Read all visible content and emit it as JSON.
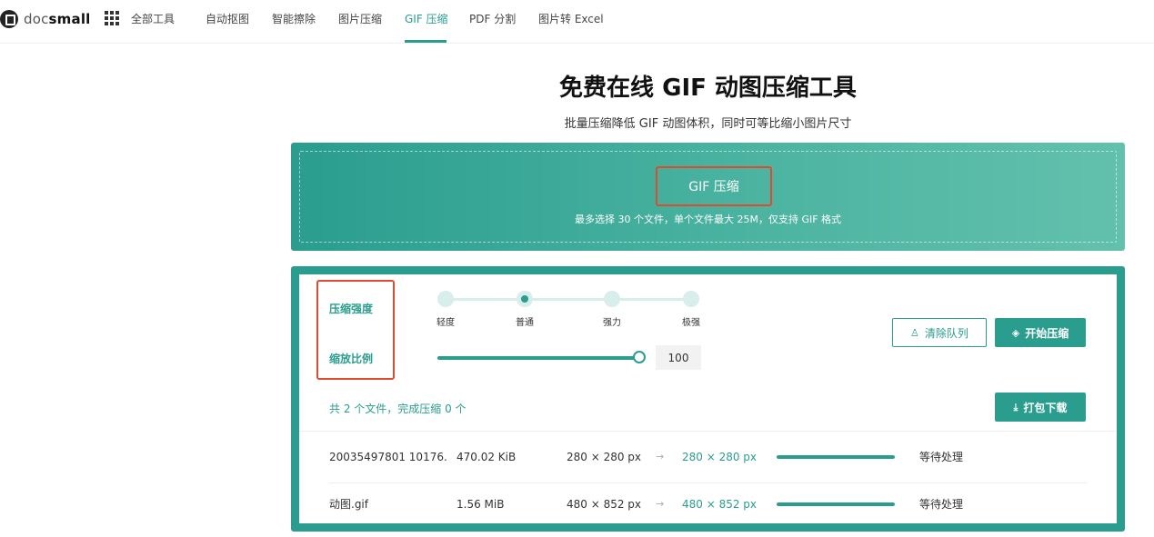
{
  "header": {
    "logo_doc": "doc",
    "logo_small": "small",
    "nav": [
      {
        "label": "全部工具",
        "active": false
      },
      {
        "label": "自动抠图",
        "active": false
      },
      {
        "label": "智能擦除",
        "active": false
      },
      {
        "label": "图片压缩",
        "active": false
      },
      {
        "label": "GIF 压缩",
        "active": true
      },
      {
        "label": "PDF 分割",
        "active": false
      },
      {
        "label": "图片转 Excel",
        "active": false
      }
    ]
  },
  "hero": {
    "title": "免费在线 GIF 动图压缩工具",
    "subtitle": "批量压缩降低 GIF 动图体积，同时可等比缩小图片尺寸"
  },
  "upload": {
    "button_label": "GIF 压缩",
    "hint": "最多选择 30 个文件，单个文件最大 25M，仅支持 GIF 格式"
  },
  "settings": {
    "strength_label": "压缩强度",
    "scale_label": "缩放比例",
    "strength_options": [
      "轻度",
      "普通",
      "强力",
      "极强"
    ],
    "strength_selected": "普通",
    "scale_value": "100",
    "scale_percent": 100
  },
  "actions": {
    "clear_label": "清除队列",
    "start_label": "开始压缩",
    "download_label": "打包下载"
  },
  "summary": "共 2 个文件，完成压缩 0 个",
  "files": [
    {
      "name": "20035497801 10176...",
      "size": "470.02 KiB",
      "original_dims": "280 × 280 px",
      "arrow": "→",
      "target_dims": "280 × 280 px",
      "progress": 100,
      "status": "等待处理"
    },
    {
      "name": "动图.gif",
      "size": "1.56 MiB",
      "original_dims": "480 × 852 px",
      "arrow": "→",
      "target_dims": "480 × 852 px",
      "progress": 100,
      "status": "等待处理"
    }
  ],
  "colors": {
    "accent": "#2a9d8f",
    "highlight_border": "#e04a2f"
  }
}
